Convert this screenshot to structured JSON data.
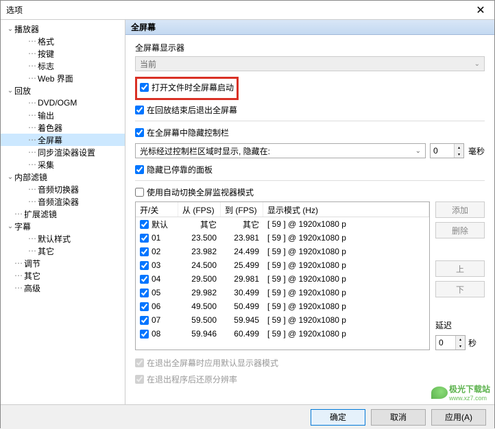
{
  "window": {
    "title": "选项"
  },
  "tree": {
    "items": [
      {
        "label": "播放器",
        "level": 1,
        "expanded": true
      },
      {
        "label": "格式",
        "level": 2
      },
      {
        "label": "按键",
        "level": 2
      },
      {
        "label": "标志",
        "level": 2
      },
      {
        "label": "Web 界面",
        "level": 2
      },
      {
        "label": "回放",
        "level": 1,
        "expanded": true
      },
      {
        "label": "DVD/OGM",
        "level": 2
      },
      {
        "label": "输出",
        "level": 2
      },
      {
        "label": "着色器",
        "level": 2
      },
      {
        "label": "全屏幕",
        "level": 2,
        "selected": true
      },
      {
        "label": "同步渲染器设置",
        "level": 2
      },
      {
        "label": "采集",
        "level": 2
      },
      {
        "label": "内部滤镜",
        "level": 1,
        "expanded": true
      },
      {
        "label": "音频切换器",
        "level": 2
      },
      {
        "label": "音频渲染器",
        "level": 2
      },
      {
        "label": "扩展滤镜",
        "level": 1,
        "leaf": true
      },
      {
        "label": "字幕",
        "level": 1,
        "expanded": true
      },
      {
        "label": "默认样式",
        "level": 2
      },
      {
        "label": "其它",
        "level": 2
      },
      {
        "label": "调节",
        "level": 1,
        "leaf": true
      },
      {
        "label": "其它",
        "level": 1,
        "leaf": true
      },
      {
        "label": "高级",
        "level": 1,
        "leaf": true
      }
    ]
  },
  "section": {
    "title": "全屏幕"
  },
  "monitor": {
    "label": "全屏幕显示器",
    "value": "当前"
  },
  "cb_open_fullscreen": {
    "label": "打开文件时全屏幕启动",
    "checked": true
  },
  "cb_exit_on_end": {
    "label": "在回放结束后退出全屏幕",
    "checked": true
  },
  "cb_hide_controls": {
    "label": "在全屏幕中隐藏控制栏",
    "checked": true
  },
  "hide_mode": {
    "value": "光标经过控制栏区域时显示, 隐藏在:"
  },
  "hide_delay": {
    "value": "0",
    "unit": "毫秒"
  },
  "cb_hide_docked": {
    "label": "隐藏已停靠的面板",
    "checked": true
  },
  "cb_auto_switch": {
    "label": "使用自动切换全屏监视器模式",
    "checked": false
  },
  "table": {
    "headers": {
      "onoff": "开/关",
      "from": "从 (FPS)",
      "to": "到 (FPS)",
      "mode": "显示模式 (Hz)"
    },
    "rows": [
      {
        "checked": true,
        "name": "默认",
        "from": "其它",
        "to": "其它",
        "mode": "[ 59 ] @ 1920x1080 p"
      },
      {
        "checked": true,
        "name": "01",
        "from": "23.500",
        "to": "23.981",
        "mode": "[ 59 ] @ 1920x1080 p"
      },
      {
        "checked": true,
        "name": "02",
        "from": "23.982",
        "to": "24.499",
        "mode": "[ 59 ] @ 1920x1080 p"
      },
      {
        "checked": true,
        "name": "03",
        "from": "24.500",
        "to": "25.499",
        "mode": "[ 59 ] @ 1920x1080 p"
      },
      {
        "checked": true,
        "name": "04",
        "from": "29.500",
        "to": "29.981",
        "mode": "[ 59 ] @ 1920x1080 p"
      },
      {
        "checked": true,
        "name": "05",
        "from": "29.982",
        "to": "30.499",
        "mode": "[ 59 ] @ 1920x1080 p"
      },
      {
        "checked": true,
        "name": "06",
        "from": "49.500",
        "to": "50.499",
        "mode": "[ 59 ] @ 1920x1080 p"
      },
      {
        "checked": true,
        "name": "07",
        "from": "59.500",
        "to": "59.945",
        "mode": "[ 59 ] @ 1920x1080 p"
      },
      {
        "checked": true,
        "name": "08",
        "from": "59.946",
        "to": "60.499",
        "mode": "[ 59 ] @ 1920x1080 p"
      }
    ]
  },
  "side_buttons": {
    "add": "添加",
    "del": "删除",
    "up": "上",
    "down": "下"
  },
  "delay": {
    "label": "延迟",
    "value": "0",
    "unit": "秒"
  },
  "cb_restore_mode": {
    "label": "在退出全屏幕时应用默认显示器模式",
    "checked": true
  },
  "cb_restore_res": {
    "label": "在退出程序后还原分辨率",
    "checked": true
  },
  "buttons": {
    "ok": "确定",
    "cancel": "取消",
    "apply": "应用(A)"
  },
  "watermark": {
    "text": "极光下载站",
    "sub": "www.xz7.com"
  }
}
